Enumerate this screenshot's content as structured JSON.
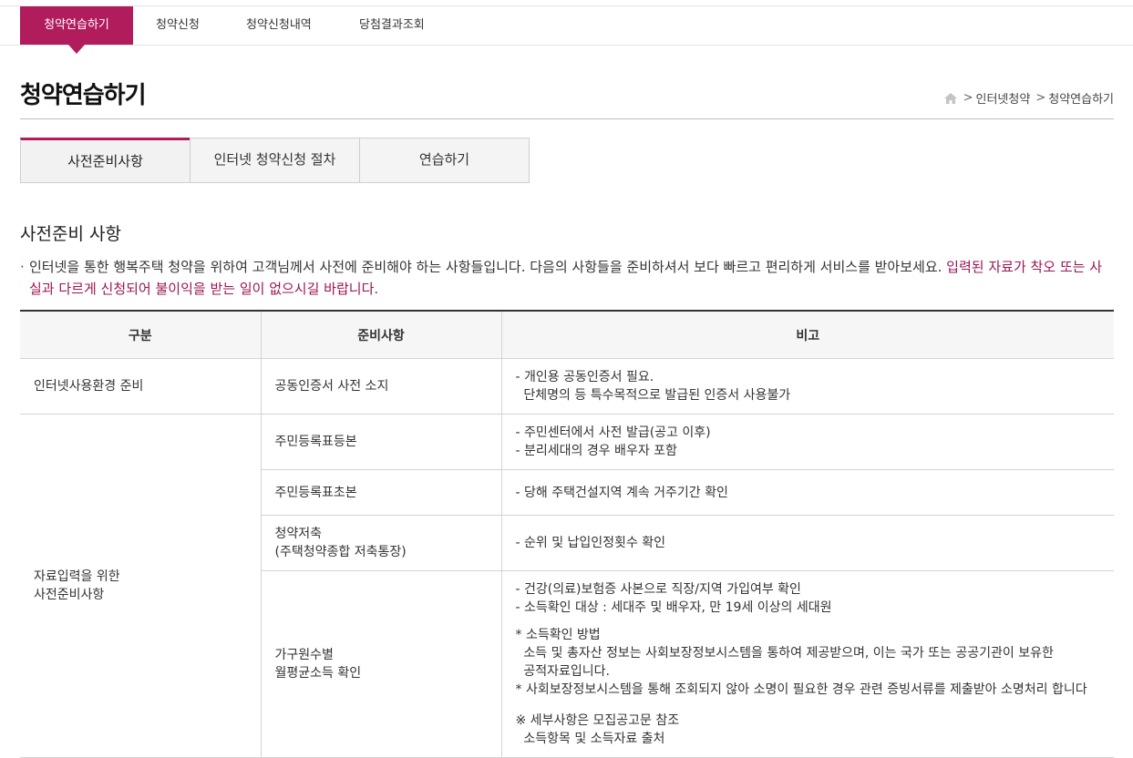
{
  "topnav": {
    "items": [
      "청약연습하기",
      "청약신청",
      "청약신청내역",
      "당첨결과조회"
    ]
  },
  "page": {
    "title": "청약연습하기"
  },
  "breadcrumb": {
    "items": [
      "인터넷청약",
      "청약연습하기"
    ],
    "separator": ">"
  },
  "tabs": [
    "사전준비사항",
    "인터넷 청약신청 절차",
    "연습하기"
  ],
  "section": {
    "title": "사전준비 사항",
    "bullet": "·",
    "intro_text": "인터넷을 통한 행복주택 청약을 위하여 고객님께서 사전에 준비해야 하는 사항들입니다. 다음의 사항들을 준비하셔서 보다 빠르고 편리하게 서비스를 받아보세요. ",
    "intro_highlight": "입력된 자료가 착오 또는 사실과 다르게 신청되어 불이익을 받는 일이 없으시길 바랍니다."
  },
  "table": {
    "headers": [
      "구분",
      "준비사항",
      "비고"
    ],
    "rows": [
      {
        "category": "인터넷사용환경 준비",
        "item": "공동인증서 사전 소지",
        "note": [
          "- 개인용 공동인증서 필요.",
          "  단체명의 등 특수목적으로 발급된 인증서 사용불가"
        ]
      },
      {
        "category": "자료입력을 위한\n사전준비사항",
        "item": "주민등록표등본",
        "note": [
          "- 주민센터에서 사전 발급(공고 이후)",
          "- 분리세대의 경우 배우자 포함"
        ]
      },
      {
        "item": "주민등록표초본",
        "note": [
          "- 당해 주택건설지역 계속 거주기간 확인"
        ]
      },
      {
        "item": "청약저축\n(주택청약종합 저축통장)",
        "note": [
          "- 순위 및 납입인정횟수 확인"
        ]
      },
      {
        "item": "가구원수별\n월평균소득 확인",
        "note": [
          "- 건강(의료)보험증 사본으로 직장/지역 가입여부 확인",
          "- 소득확인 대상 : 세대주 및 배우자, 만 19세 이상의 세대원",
          "",
          "* 소득확인 방법",
          "  소득 및 총자산 정보는 사회보장정보시스템을 통하여 제공받으며, 이는 국가 또는 공공기관이 보유한",
          "  공적자료입니다.",
          "* 사회보장정보시스템을 통해 조회되지 않아 소명이 필요한 경우 관련 증빙서류를 제출받아 소명처리 합니다",
          "",
          "※ 세부사항은 모집공고문 참조",
          "  소득항목 및 소득자료 출처"
        ]
      }
    ]
  },
  "colors": {
    "accent": "#b01c5c",
    "highlight_text": "#9c1455"
  }
}
